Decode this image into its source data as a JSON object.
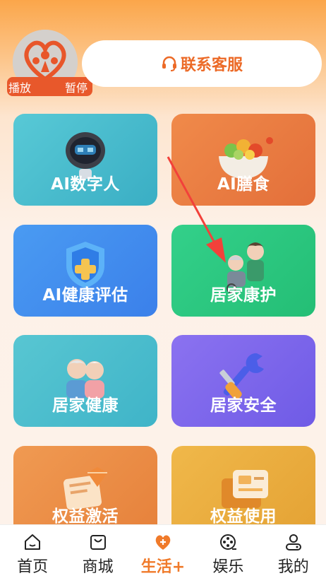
{
  "header": {
    "avatar_play": "播放",
    "avatar_pause": "暂停",
    "contact_label": "联系客服"
  },
  "tiles": [
    {
      "label": "AI数字人",
      "icon": "robot-icon",
      "color": "#3bb4c9"
    },
    {
      "label": "AI膳食",
      "icon": "salad-icon",
      "color": "#ec7f43"
    },
    {
      "label": "AI健康评估",
      "icon": "health-shield-icon",
      "color": "#3f8ef0"
    },
    {
      "label": "居家康护",
      "icon": "caregiver-icon",
      "color": "#2cc27a"
    },
    {
      "label": "居家健康",
      "icon": "elderly-couple-icon",
      "color": "#47bcd0"
    },
    {
      "label": "居家安全",
      "icon": "tools-icon",
      "color": "#7f6cf0"
    },
    {
      "label": "权益激活",
      "icon": "gift-card-icon",
      "color": "#ec8d45"
    },
    {
      "label": "权益使用",
      "icon": "card-icon",
      "color": "#e8ac3e"
    }
  ],
  "tabbar": {
    "items": [
      {
        "label": "首页",
        "icon": "home-icon"
      },
      {
        "label": "商城",
        "icon": "shopping-bag-icon"
      },
      {
        "label": "生活+",
        "icon": "heart-plus-icon",
        "active": true
      },
      {
        "label": "娱乐",
        "icon": "film-reel-icon"
      },
      {
        "label": "我的",
        "icon": "user-icon"
      }
    ]
  }
}
